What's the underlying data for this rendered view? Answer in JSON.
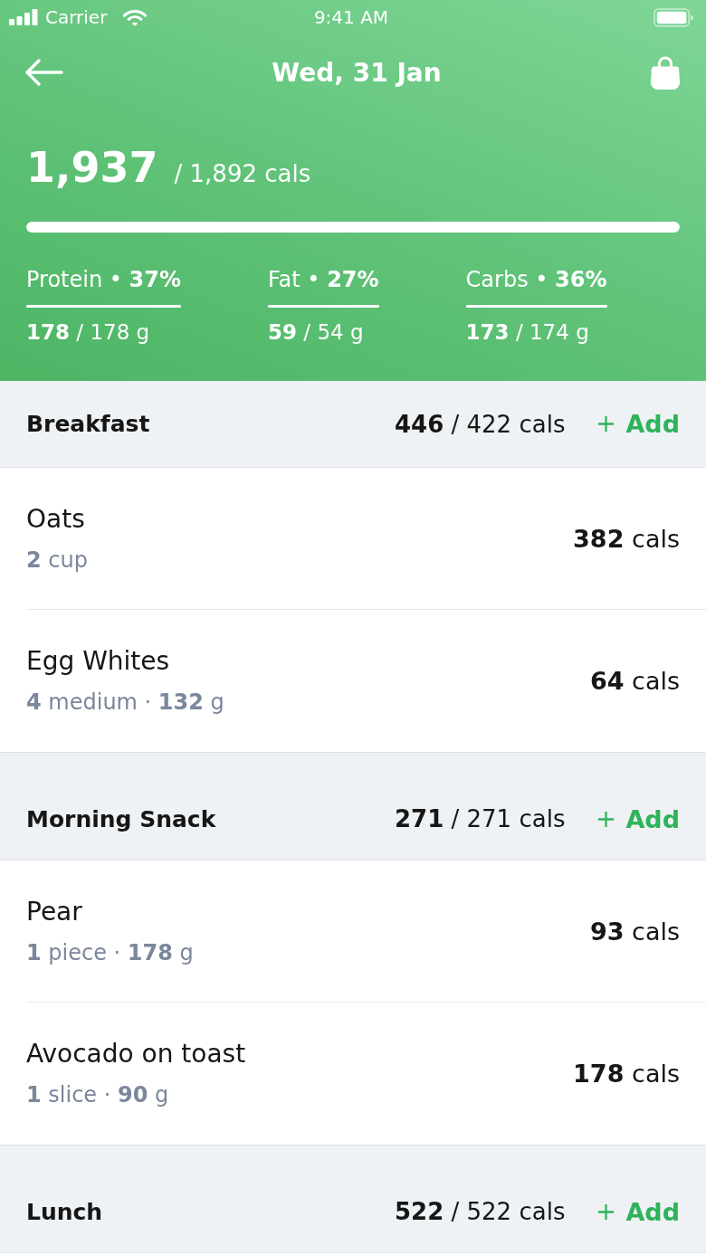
{
  "status_bar": {
    "carrier": "Carrier",
    "time": "9:41 AM"
  },
  "nav": {
    "title": "Wed, 31 Jan"
  },
  "summary": {
    "consumed": "1,937",
    "target": "/ 1,892 cals",
    "level": 1
  },
  "macros": [
    {
      "label": "Protein • **37%**",
      "level": 1,
      "amount": "**178** / 178 g"
    },
    {
      "label": "Fat • **27%**",
      "level": 1,
      "amount": "**59** / 54 g"
    },
    {
      "label": "Carbs • **36%**",
      "level": 1,
      "amount": "**173** / 174 g"
    }
  ],
  "meals": [
    {
      "name": "Breakfast",
      "calories": "**446** / 422 cals",
      "add_label": "Add",
      "items": [
        {
          "name": "Oats",
          "detail": "**2** cup",
          "calories": "**382** cals"
        },
        {
          "name": "Egg Whites",
          "detail": "**4** medium · **132** g",
          "calories": "**64** cals"
        }
      ]
    },
    {
      "name": "Morning Snack",
      "calories": "**271** / 271 cals",
      "add_label": "Add",
      "items": [
        {
          "name": "Pear",
          "detail": "**1** piece · **178** g",
          "calories": "**93** cals"
        },
        {
          "name": "Avocado on toast",
          "detail": "**1** slice · **90** g",
          "calories": "**178** cals"
        }
      ]
    },
    {
      "name": "Lunch",
      "calories": "**522** / 522 cals",
      "add_label": "Add"
    }
  ]
}
